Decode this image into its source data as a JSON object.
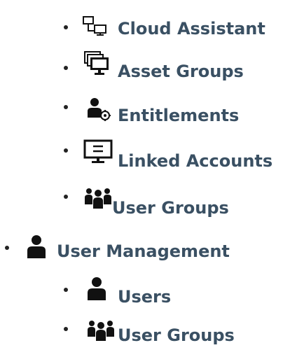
{
  "menu": {
    "items": [
      {
        "label": "Cloud Assistant",
        "icon": "cloud-assistant-network-icon"
      },
      {
        "label": "Asset Groups",
        "icon": "asset-groups-monitors-icon"
      },
      {
        "label": "Entitlements",
        "icon": "entitlements-user-gear-icon"
      },
      {
        "label": "Linked Accounts",
        "icon": "linked-accounts-monitor-icon"
      },
      {
        "label": "User Groups",
        "icon": "user-groups-icon"
      }
    ],
    "user_management": {
      "label": "User Management",
      "icon": "user-icon",
      "children": [
        {
          "label": "Users",
          "icon": "user-icon"
        },
        {
          "label": "User Groups",
          "icon": "user-groups-icon"
        }
      ]
    }
  },
  "colors": {
    "label": "#3a5063",
    "bullet": "#222222",
    "icon": "#111111"
  }
}
